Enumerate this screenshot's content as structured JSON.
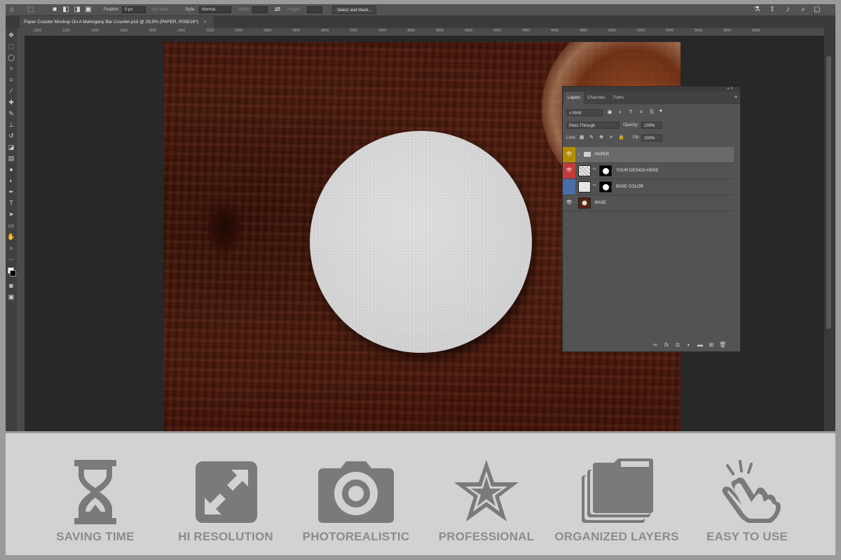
{
  "options_bar": {
    "feather_label": "Feather:",
    "feather_value": "0 px",
    "anti_alias_label": "Anti-alias",
    "style_label": "Style:",
    "style_value": "Normal",
    "width_label": "Width:",
    "height_label": "Height:",
    "select_mask_label": "Select and Mask..."
  },
  "document_tab": {
    "title": "Paper Coaster Mockup On A Mahogany Bar Counter.psd @ 29,5% (PAPER, RGB/16*)",
    "close": "×"
  },
  "ruler_ticks": [
    "1000",
    "1200",
    "1400",
    "1600",
    "1800",
    "2000",
    "2200",
    "2400",
    "2600",
    "2800",
    "3000",
    "3200",
    "3400",
    "3600",
    "3800",
    "4000",
    "4200",
    "4400",
    "4600",
    "4800",
    "5000",
    "5200",
    "5400",
    "5600",
    "5800",
    "6000"
  ],
  "layers_panel": {
    "tabs": [
      "Layers",
      "Channels",
      "Paths"
    ],
    "filter_kind": "Kind",
    "blend_mode": "Pass Through",
    "opacity_label": "Opacity:",
    "opacity_value": "100%",
    "lock_label": "Lock:",
    "fill_label": "Fill:",
    "fill_value": "100%",
    "layers": [
      {
        "name": "PAPER",
        "color": "#b38d00",
        "type": "group"
      },
      {
        "name": "YOUR DESIGN HERE",
        "color": "#c23b3b",
        "type": "smart"
      },
      {
        "name": "BASE COLOR",
        "color": "#4a6fa8",
        "type": "fill"
      },
      {
        "name": "BASE",
        "color": "",
        "type": "image"
      }
    ]
  },
  "features": [
    {
      "label": "SAVING TIME",
      "icon": "hourglass-icon"
    },
    {
      "label": "HI RESOLUTION",
      "icon": "expand-arrows-icon"
    },
    {
      "label": "PHOTOREALISTIC",
      "icon": "camera-icon"
    },
    {
      "label": "PROFESSIONAL",
      "icon": "star-icon"
    },
    {
      "label": "ORGANIZED LAYERS",
      "icon": "stacked-folders-icon"
    },
    {
      "label": "EASY TO USE",
      "icon": "tapping-hand-icon"
    }
  ],
  "colors": {
    "feature_icon": "#7a7a7a",
    "feature_label": "#8c8c8c",
    "strip_bg": "#d2d2d2"
  }
}
